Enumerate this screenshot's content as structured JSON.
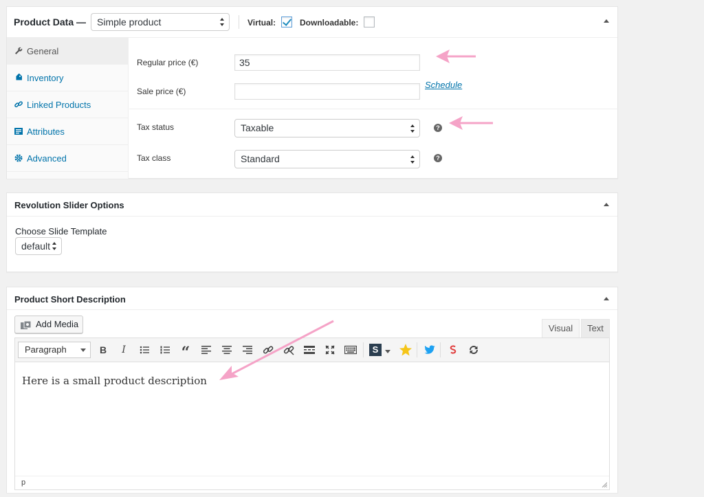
{
  "product_data": {
    "title": "Product Data —",
    "product_type": "Simple product",
    "virtual_label": "Virtual:",
    "virtual_checked": true,
    "downloadable_label": "Downloadable:",
    "downloadable_checked": false,
    "tabs": [
      {
        "label": "General",
        "icon": "wrench-icon",
        "active": true
      },
      {
        "label": "Inventory",
        "icon": "tag-icon",
        "active": false
      },
      {
        "label": "Linked Products",
        "icon": "link-icon",
        "active": false
      },
      {
        "label": "Attributes",
        "icon": "list-icon",
        "active": false
      },
      {
        "label": "Advanced",
        "icon": "gear-icon",
        "active": false
      }
    ],
    "general": {
      "regular_price_label": "Regular price (€)",
      "regular_price_value": "35",
      "sale_price_label": "Sale price (€)",
      "sale_price_value": "",
      "schedule_link": "Schedule",
      "tax_status_label": "Tax status",
      "tax_status_value": "Taxable",
      "tax_class_label": "Tax class",
      "tax_class_value": "Standard",
      "help_glyph": "?"
    }
  },
  "revolution_slider": {
    "title": "Revolution Slider Options",
    "template_label": "Choose Slide Template",
    "template_value": "default"
  },
  "short_description": {
    "title": "Product Short Description",
    "add_media_label": "Add Media",
    "tab_visual": "Visual",
    "tab_text": "Text",
    "format_select": "Paragraph",
    "toolbar": {
      "bold": "B",
      "italic": "I",
      "blockquote": "“",
      "special_s": "S"
    },
    "content": "Here is a small product description",
    "status_path": "p"
  },
  "colors": {
    "accent_link": "#0073aa",
    "annotation_arrow": "#f5a3c7",
    "star": "#f5c518",
    "twitter": "#1da1f2"
  }
}
